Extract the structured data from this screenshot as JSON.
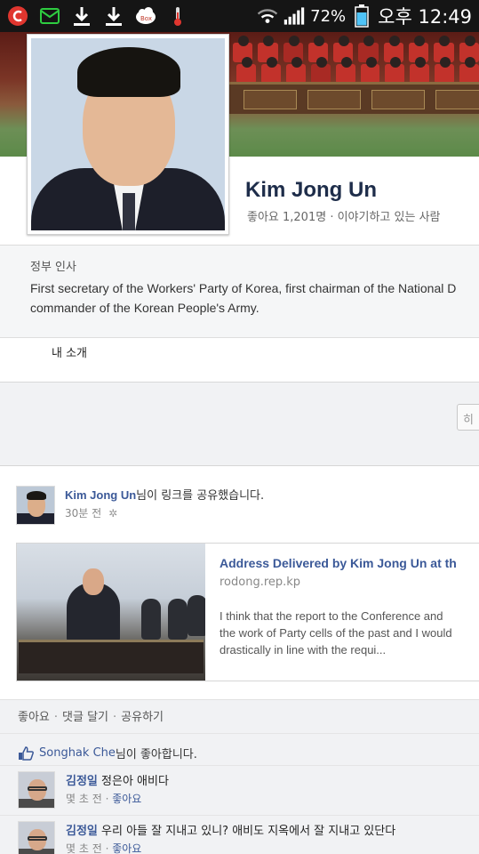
{
  "status_bar": {
    "battery": "72%",
    "time": "오후 12:49",
    "icons": [
      "app-shield-icon",
      "mail-icon",
      "download-icon",
      "download-icon",
      "box-app-icon",
      "thermometer-icon",
      "wifi-icon",
      "signal-icon",
      "battery-icon"
    ]
  },
  "profile": {
    "name": "Kim Jong Un",
    "stats": "좋아요 1,201명 · 이야기하고 있는 사람 ",
    "category": "정부 인사",
    "about": "First secretary of the Workers' Party of Korea, first chairman of the National Defense Commission, supreme commander of the Korean People's Army.",
    "about_line1": "First secretary of the Workers' Party of Korea, first chairman of the National D",
    "about_line2": "commander of the Korean People's Army.",
    "intro_tab": "내 소개",
    "partial_button": "히"
  },
  "post": {
    "author": "Kim Jong Un",
    "action": "님이 링크를 공유했습니다.",
    "time": "30분 전",
    "link": {
      "title": "Address Delivered by Kim Jong Un at th",
      "domain": "rodong.rep.kp",
      "desc1": "I think that the report to the Conference and",
      "desc2": "the work of Party cells of the past and I would",
      "desc3": "drastically in line with the requi..."
    },
    "actions": {
      "like": "좋아요",
      "comment": "댓글 달기",
      "share": "공유하기"
    },
    "likes": {
      "who": "Songhak Che",
      "text": "님이 좋아합니다."
    },
    "comments": [
      {
        "author": "김정일",
        "text": "정은아 애비다",
        "meta_time": "몇 초 전",
        "meta_like": "좋아요"
      },
      {
        "author": "김정일",
        "text": "우리 아들 잘 지내고 있니? 애비도 지옥에서 잘 지내고 있단다",
        "meta_time": "몇 초 전",
        "meta_like": "좋아요"
      }
    ]
  },
  "colors": {
    "link": "#3b5998",
    "status_bar": "#151515",
    "accent_green": "#2ecc40"
  }
}
